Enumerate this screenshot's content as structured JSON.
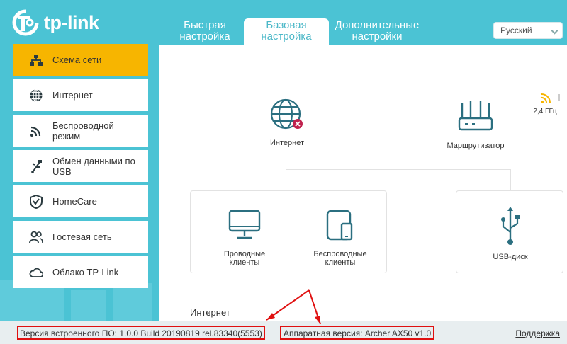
{
  "brand": {
    "logo_text": "tp-link"
  },
  "header": {
    "tabs": [
      {
        "label_line1": "Быстрая",
        "label_line2": "настройка"
      },
      {
        "label_line1": "Базовая",
        "label_line2": "настройка"
      },
      {
        "label_line1": "Дополнительные",
        "label_line2": "настройки"
      }
    ],
    "language": "Русский"
  },
  "sidebar": {
    "items": [
      {
        "label": "Схема сети",
        "icon": "network-map-icon"
      },
      {
        "label": "Интернет",
        "icon": "globe-icon"
      },
      {
        "label": "Беспроводной режим",
        "icon": "wireless-icon"
      },
      {
        "label": "Обмен данными по USB",
        "icon": "usb-icon"
      },
      {
        "label": "HomeCare",
        "icon": "shield-icon"
      },
      {
        "label": "Гостевая сеть",
        "icon": "guests-icon"
      },
      {
        "label": "Облако TP-Link",
        "icon": "cloud-icon"
      }
    ]
  },
  "map": {
    "internet_label": "Интернет",
    "router_label": "Маршрутизатор",
    "wifi_band": "2,4 ГГц",
    "wired_line1": "Проводные",
    "wired_line2": "клиенты",
    "wireless_line1": "Беспроводные",
    "wireless_line2": "клиенты",
    "usb_label": "USB-диск"
  },
  "section": {
    "title": "Интернет"
  },
  "footer": {
    "firmware": "Версия встроенного ПО: 1.0.0 Build 20190819 rel.83340(5553)",
    "hardware": "Аппаратная версия: Archer AX50 v1.0",
    "support": "Поддержка"
  },
  "colors": {
    "accent": "#4bc3d4",
    "active": "#f7b500",
    "icon": "#2b6f80",
    "highlight": "#e01010"
  }
}
